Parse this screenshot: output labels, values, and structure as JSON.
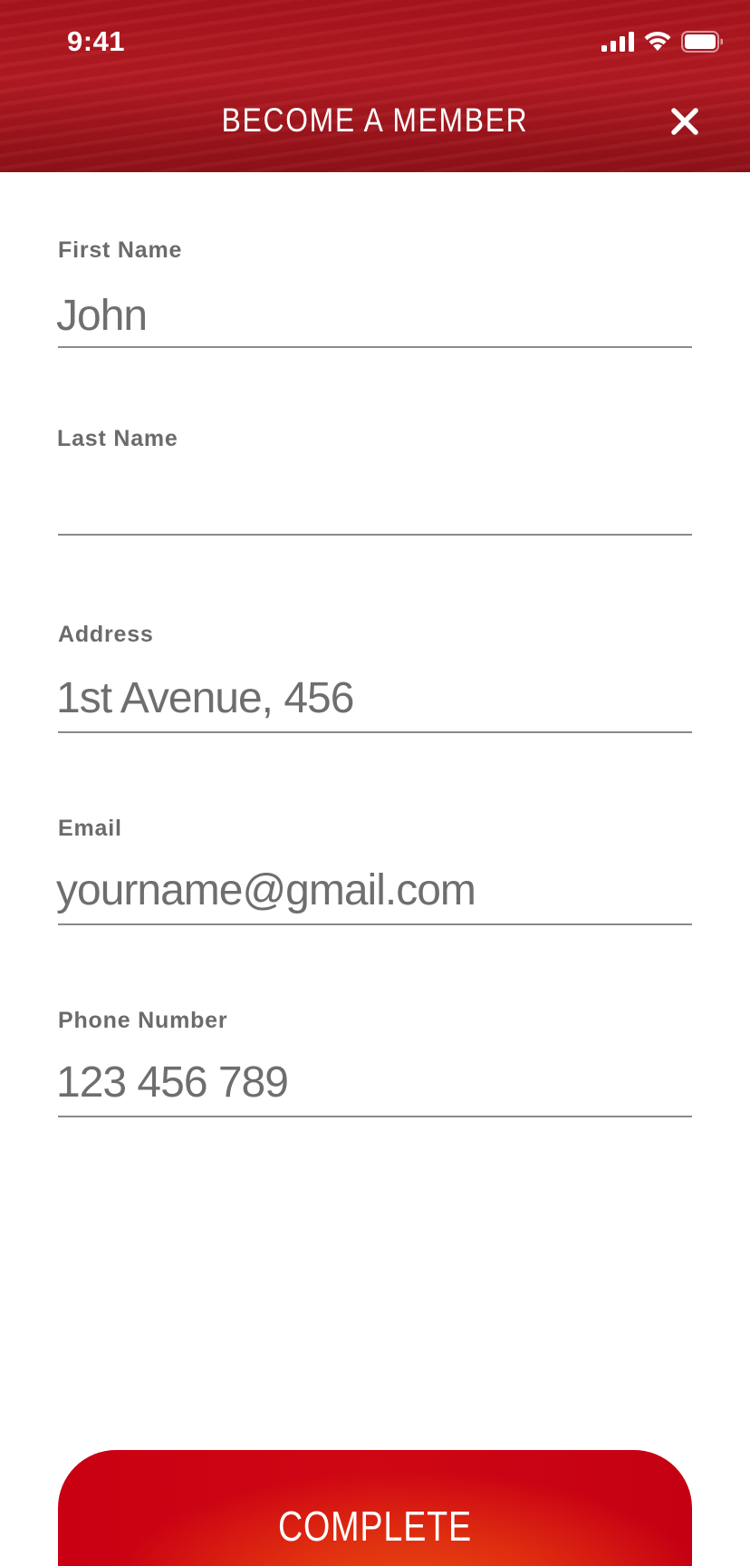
{
  "status_bar": {
    "time": "9:41",
    "icons": [
      "cellular-signal-icon",
      "wifi-icon",
      "battery-icon"
    ]
  },
  "header": {
    "title": "BECOME A MEMBER",
    "close_icon": "close-icon"
  },
  "form": {
    "first_name": {
      "label": "First Name",
      "value": "John"
    },
    "last_name": {
      "label": "Last Name",
      "value": ""
    },
    "address": {
      "label": "Address",
      "placeholder": "1st Avenue, 456"
    },
    "email": {
      "label": "Email",
      "placeholder": "yourname@gmail.com"
    },
    "phone": {
      "label": "Phone Number",
      "placeholder": "123 456 789"
    }
  },
  "actions": {
    "complete_label": "COMPLETE"
  },
  "colors": {
    "header_red": "#a8141c",
    "button_red": "#c90012",
    "button_orange": "#e8490f",
    "label_gray": "#6b6b6b",
    "underline_gray": "#8a8a8a"
  }
}
